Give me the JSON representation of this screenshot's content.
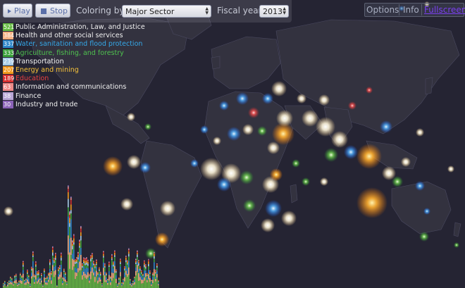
{
  "toolbar": {
    "play_label": "Play",
    "stop_label": "Stop",
    "coloring_label": "Coloring by:",
    "coloring_value": "Major Sector",
    "year_label": "Fiscal year:",
    "year_value": "2013"
  },
  "topright": {
    "options_label": "Options",
    "info_label": "Info",
    "fullscreen_label": "Fullscreen"
  },
  "legend": [
    {
      "count": "521",
      "label": "Public Administration, Law, and Justice",
      "color": "#68bd45",
      "text_color": "#f0f0f0"
    },
    {
      "count": "384",
      "label": "Health and other social services",
      "color": "#f4b183",
      "text_color": "#f0f0f0"
    },
    {
      "count": "337",
      "label": "Water, sanitation and flood protection",
      "color": "#2e86c8",
      "text_color": "#35a8e8"
    },
    {
      "count": "333",
      "label": "Agriculture, fishing, and forestry",
      "color": "#3aa03a",
      "text_color": "#4fc24f"
    },
    {
      "count": "239",
      "label": "Transportation",
      "color": "#a6cbe6",
      "text_color": "#f0f0f0"
    },
    {
      "count": "207",
      "label": "Energy and mining",
      "color": "#f39a1e",
      "text_color": "#f7c33a"
    },
    {
      "count": "189",
      "label": "Education",
      "color": "#d62e2e",
      "text_color": "#e84040"
    },
    {
      "count": "63",
      "label": "Information and communications",
      "color": "#ee8a88",
      "text_color": "#f0f0f0"
    },
    {
      "count": "38",
      "label": "Finance",
      "color": "#b9a6d6",
      "text_color": "#f0f0f0"
    },
    {
      "count": "30",
      "label": "Industry and trade",
      "color": "#8b63b8",
      "text_color": "#f0f0f0"
    }
  ],
  "colors": {
    "background": "#252433",
    "land": "#33323f",
    "land_border": "#4a4960"
  }
}
